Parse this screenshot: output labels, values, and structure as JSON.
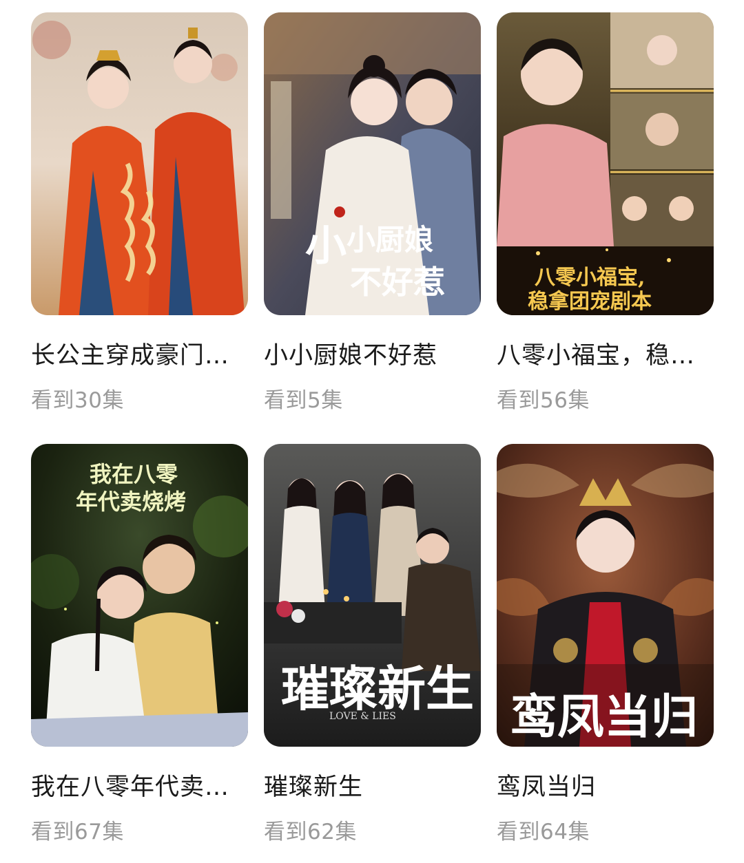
{
  "dramas": [
    {
      "title": "长公主穿成豪门…",
      "progress": "看到30集",
      "poster_art": "orange-wedding-robes-couple"
    },
    {
      "title": "小小厨娘不好惹",
      "progress": "看到5集",
      "poster_art": "hanfu-couple-kitchen"
    },
    {
      "title": "八零小福宝，稳…",
      "progress": "看到56集",
      "poster_art": "family-collage-gold"
    },
    {
      "title": "我在八零年代卖…",
      "progress": "看到67集",
      "poster_art": "couple-night-forest"
    },
    {
      "title": "璀璨新生",
      "progress": "看到62集",
      "poster_art": "group-dark-dinner"
    },
    {
      "title": "鸾凤当归",
      "progress": "看到64集",
      "poster_art": "empress-red-gold"
    }
  ]
}
